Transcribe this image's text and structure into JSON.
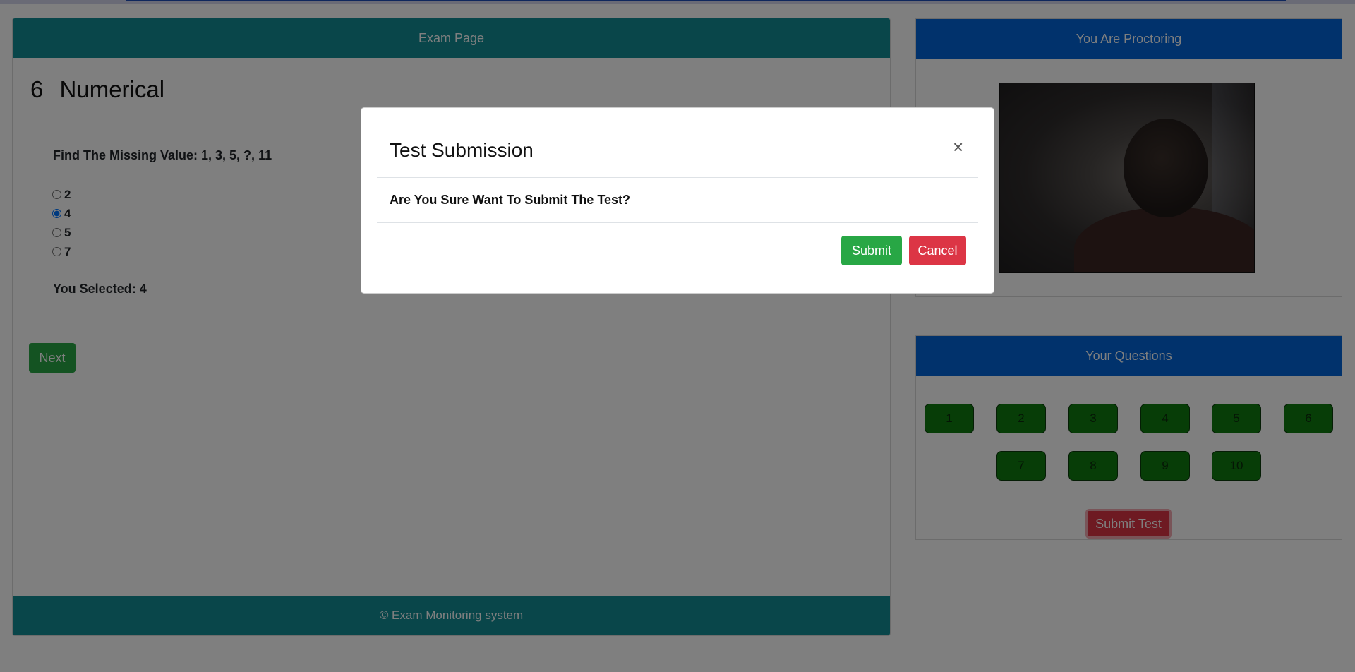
{
  "exam": {
    "header": "Exam Page",
    "question_number": "6",
    "question_category": "Numerical",
    "question_text": "Find The Missing Value: 1, 3, 5, ?, 11",
    "options": [
      {
        "label": "2",
        "checked": false
      },
      {
        "label": "4",
        "checked": true
      },
      {
        "label": "5",
        "checked": false
      },
      {
        "label": "7",
        "checked": false
      }
    ],
    "selected_text": "You Selected: 4",
    "next_label": "Next",
    "footer": "© Exam Monitoring system"
  },
  "proctor": {
    "header": "You Are Proctoring"
  },
  "questions_panel": {
    "header": "Your Questions",
    "buttons": [
      "1",
      "2",
      "3",
      "4",
      "5",
      "6",
      "7",
      "8",
      "9",
      "10"
    ],
    "submit_test_label": "Submit Test"
  },
  "modal": {
    "title": "Test Submission",
    "close_symbol": "×",
    "body": "Are You Sure Want To Submit The Test?",
    "submit_label": "Submit",
    "cancel_label": "Cancel"
  },
  "colors": {
    "teal": "#138d95",
    "blue": "#0264d8",
    "green": "#28a745",
    "red": "#dc3545"
  }
}
